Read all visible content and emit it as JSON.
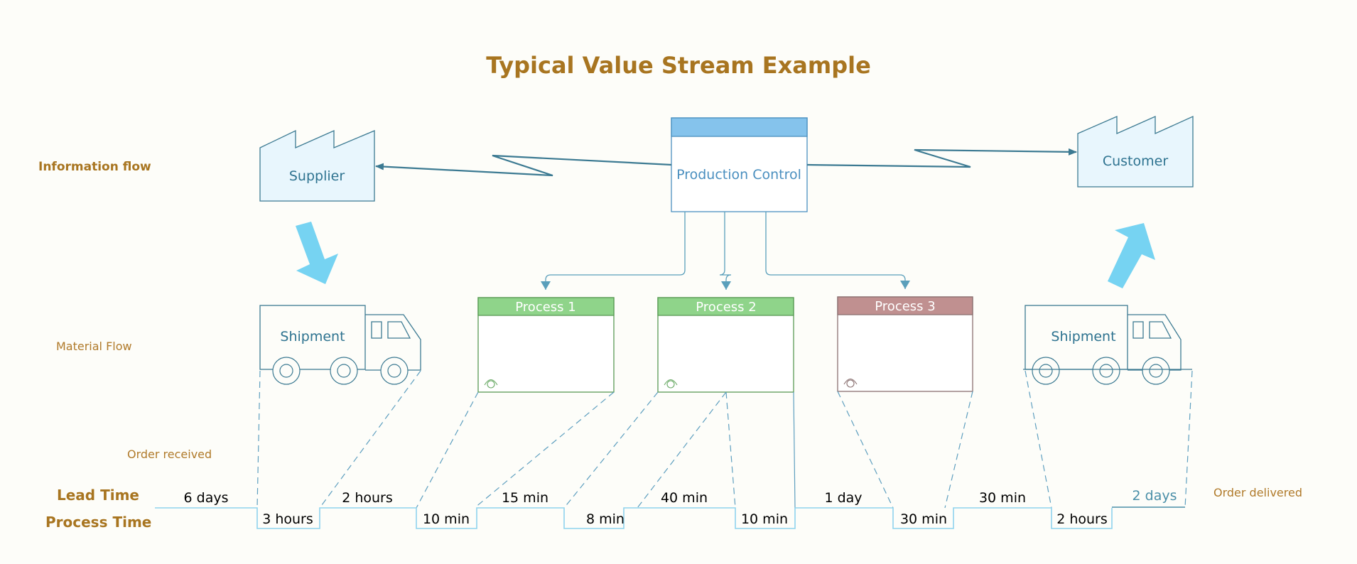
{
  "title": "Typical Value Stream Example",
  "lanes": {
    "information_flow": "Information flow",
    "material_flow": "Material Flow",
    "order_received": "Order received",
    "order_delivered": "Order delivered",
    "lead_time": "Lead Time",
    "process_time": "Process Time"
  },
  "entities": {
    "supplier": "Supplier",
    "customer": "Customer",
    "production_control": "Production Control",
    "shipment_in": "Shipment",
    "shipment_out": "Shipment"
  },
  "processes": [
    {
      "label": "Process 1",
      "header_color": "#8fd48a",
      "border_color": "#5a9a55"
    },
    {
      "label": "Process 2",
      "header_color": "#8fd48a",
      "border_color": "#5a9a55"
    },
    {
      "label": "Process 3",
      "header_color": "#c09090",
      "border_color": "#8a7070"
    }
  ],
  "timeline": {
    "lead_times": [
      "6 days",
      "2 hours",
      "15 min",
      "40 min",
      "1 day",
      "30 min",
      "2 days"
    ],
    "process_times": [
      "3 hours",
      "10 min",
      "8 min",
      "10 min",
      "30 min",
      "2 hours"
    ]
  },
  "colors": {
    "title": "#a87520",
    "factory_fill": "#e8f6fd",
    "stroke": "#3c7a92",
    "push_arrow": "#76d3f2",
    "pc_header": "#85c3ec",
    "timeline": "#8fd3ee"
  }
}
